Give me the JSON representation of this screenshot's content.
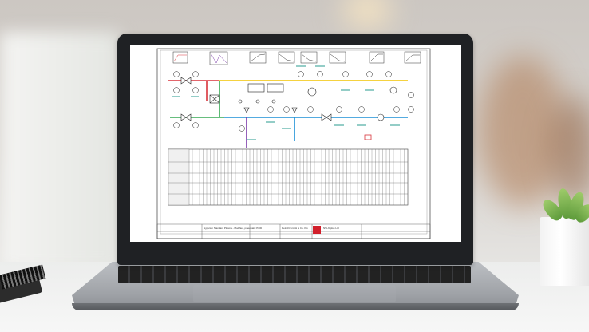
{
  "scene": {
    "description_colors": {
      "screen_bg": "#ffffff",
      "pipe_yellow": "#f2c300",
      "pipe_blue": "#1c8fd6",
      "pipe_green": "#35a853",
      "pipe_red": "#d8343b",
      "pipe_purple": "#7b3aa8",
      "instrument_teal": "#2a9b8f",
      "logo_red": "#d21f2b"
    }
  },
  "drawing": {
    "title_block": {
      "project_text": "Hyperion Standard Plasma - Modified, pneumatic P&ID",
      "company": "Retrofit GmbH & Co. KG",
      "vendor": "NSL/Gplus Ltd"
    }
  }
}
